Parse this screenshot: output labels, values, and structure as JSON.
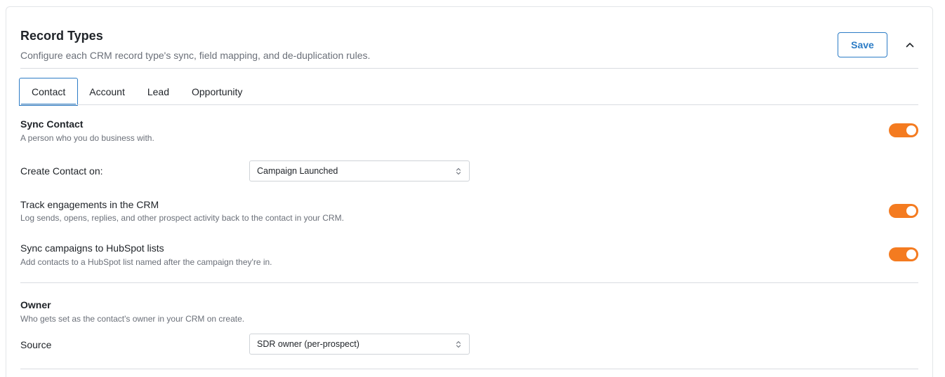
{
  "header": {
    "title": "Record Types",
    "subtitle": "Configure each CRM record type's sync, field mapping, and de-duplication rules.",
    "save_label": "Save",
    "collapse_icon": "chevron-up-icon"
  },
  "tabs": [
    {
      "label": "Contact",
      "active": true
    },
    {
      "label": "Account",
      "active": false
    },
    {
      "label": "Lead",
      "active": false
    },
    {
      "label": "Opportunity",
      "active": false
    }
  ],
  "sync_contact": {
    "title": "Sync Contact",
    "description": "A person who you do business with.",
    "enabled": true
  },
  "create_contact": {
    "label": "Create Contact on:",
    "value": "Campaign Launched"
  },
  "track_engagements": {
    "title": "Track engagements in the CRM",
    "description": "Log sends, opens, replies, and other prospect activity back to the contact in your CRM.",
    "enabled": true
  },
  "sync_campaigns": {
    "title": "Sync campaigns to HubSpot lists",
    "description": "Add contacts to a HubSpot list named after the campaign they're in.",
    "enabled": true
  },
  "owner": {
    "title": "Owner",
    "description": "Who gets set as the contact's owner in your CRM on create.",
    "source_label": "Source",
    "source_value": "SDR owner (per-prospect)"
  },
  "colors": {
    "accent": "#2c7cc6",
    "toggle_on": "#f47b20"
  }
}
